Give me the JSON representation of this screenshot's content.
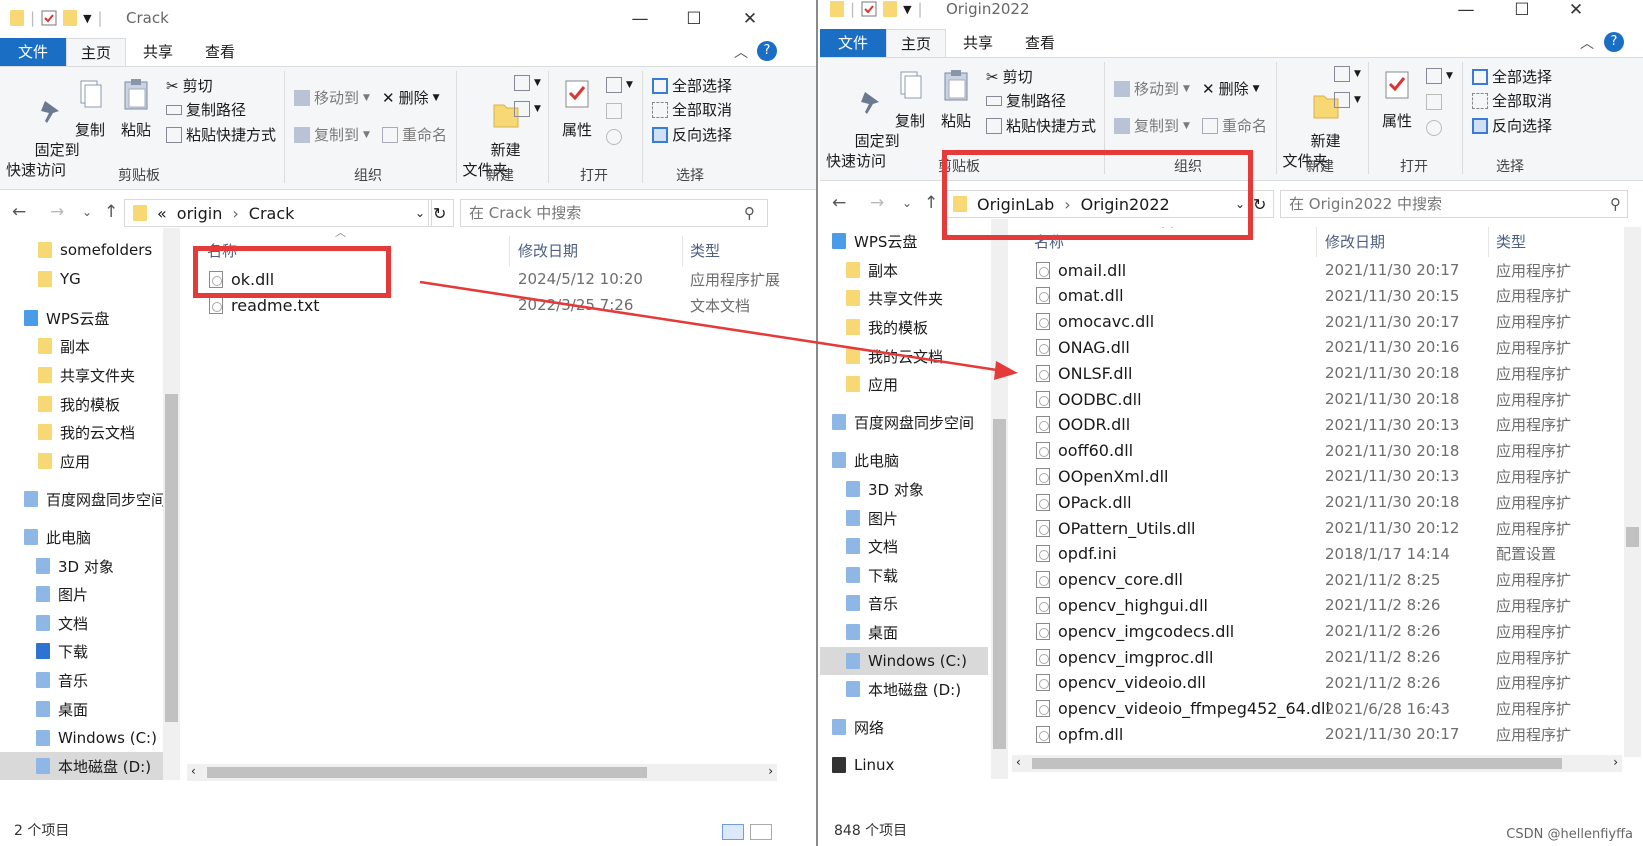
{
  "ribbon": {
    "tabs": [
      "文件",
      "主页",
      "共享",
      "查看"
    ],
    "pin": "固定到\n快速访问",
    "copy": "复制",
    "paste": "粘贴",
    "cut": "剪切",
    "copy_path": "复制路径",
    "paste_shortcut": "粘贴快捷方式",
    "move_to": "移动到",
    "copy_to": "复制到",
    "delete": "删除",
    "rename": "重命名",
    "new_folder": "新建\n文件夹",
    "properties": "属性",
    "select_all": "全部选择",
    "select_none": "全部取消",
    "invert_select": "反向选择",
    "groups": {
      "clipboard": "剪贴板",
      "organize": "组织",
      "new": "新建",
      "open": "打开",
      "select": "选择"
    }
  },
  "columns": {
    "name": "名称",
    "date": "修改日期",
    "type": "类型"
  },
  "left": {
    "title": "Crack",
    "path": [
      "«",
      "origin",
      "Crack"
    ],
    "search_placeholder": "在 Crack 中搜索",
    "nav": [
      "somefolders",
      "YG",
      "WPS云盘",
      "副本",
      "共享文件夹",
      "我的模板",
      "我的云文档",
      "应用",
      "百度网盘同步空间",
      "此电脑",
      "3D 对象",
      "图片",
      "文档",
      "下载",
      "音乐",
      "桌面",
      "Windows (C:)",
      "本地磁盘 (D:)"
    ],
    "files": [
      {
        "name": "ok.dll",
        "date": "2024/5/12 10:20",
        "type": "应用程序扩展"
      },
      {
        "name": "readme.txt",
        "date": "2022/3/25 7:26",
        "type": "文本文档"
      }
    ],
    "status": "2 个项目"
  },
  "right": {
    "title": "Origin2022",
    "path": [
      "OriginLab",
      "Origin2022"
    ],
    "search_placeholder": "在 Origin2022 中搜索",
    "nav": [
      "WPS云盘",
      "副本",
      "共享文件夹",
      "我的模板",
      "我的云文档",
      "应用",
      "百度网盘同步空间",
      "此电脑",
      "3D 对象",
      "图片",
      "文档",
      "下载",
      "音乐",
      "桌面",
      "Windows (C:)",
      "本地磁盘 (D:)",
      "网络",
      "Linux"
    ],
    "files": [
      {
        "name": "omail.dll",
        "date": "2021/11/30 20:17",
        "type": "应用程序扩"
      },
      {
        "name": "omat.dll",
        "date": "2021/11/30 20:15",
        "type": "应用程序扩"
      },
      {
        "name": "omocavc.dll",
        "date": "2021/11/30 20:17",
        "type": "应用程序扩"
      },
      {
        "name": "ONAG.dll",
        "date": "2021/11/30 20:16",
        "type": "应用程序扩"
      },
      {
        "name": "ONLSF.dll",
        "date": "2021/11/30 20:18",
        "type": "应用程序扩"
      },
      {
        "name": "OODBC.dll",
        "date": "2021/11/30 20:18",
        "type": "应用程序扩"
      },
      {
        "name": "OODR.dll",
        "date": "2021/11/30 20:13",
        "type": "应用程序扩"
      },
      {
        "name": "ooff60.dll",
        "date": "2021/11/30 20:18",
        "type": "应用程序扩"
      },
      {
        "name": "OOpenXml.dll",
        "date": "2021/11/30 20:13",
        "type": "应用程序扩"
      },
      {
        "name": "OPack.dll",
        "date": "2021/11/30 20:18",
        "type": "应用程序扩"
      },
      {
        "name": "OPattern_Utils.dll",
        "date": "2021/11/30 20:12",
        "type": "应用程序扩"
      },
      {
        "name": "opdf.ini",
        "date": "2018/1/17 14:14",
        "type": "配置设置"
      },
      {
        "name": "opencv_core.dll",
        "date": "2021/11/2 8:25",
        "type": "应用程序扩"
      },
      {
        "name": "opencv_highgui.dll",
        "date": "2021/11/2 8:26",
        "type": "应用程序扩"
      },
      {
        "name": "opencv_imgcodecs.dll",
        "date": "2021/11/2 8:26",
        "type": "应用程序扩"
      },
      {
        "name": "opencv_imgproc.dll",
        "date": "2021/11/2 8:26",
        "type": "应用程序扩"
      },
      {
        "name": "opencv_videoio.dll",
        "date": "2021/11/2 8:26",
        "type": "应用程序扩"
      },
      {
        "name": "opencv_videoio_ffmpeg452_64.dll",
        "date": "2021/6/28 16:43",
        "type": "应用程序扩"
      },
      {
        "name": "opfm.dll",
        "date": "2021/11/30 20:17",
        "type": "应用程序扩"
      }
    ],
    "status": "848 个项目"
  },
  "watermark": "CSDN @hellenfiyffa",
  "colors": {
    "accent": "#1a6fc4",
    "annotation": "#e43a3a",
    "folder": "#f8d775"
  }
}
